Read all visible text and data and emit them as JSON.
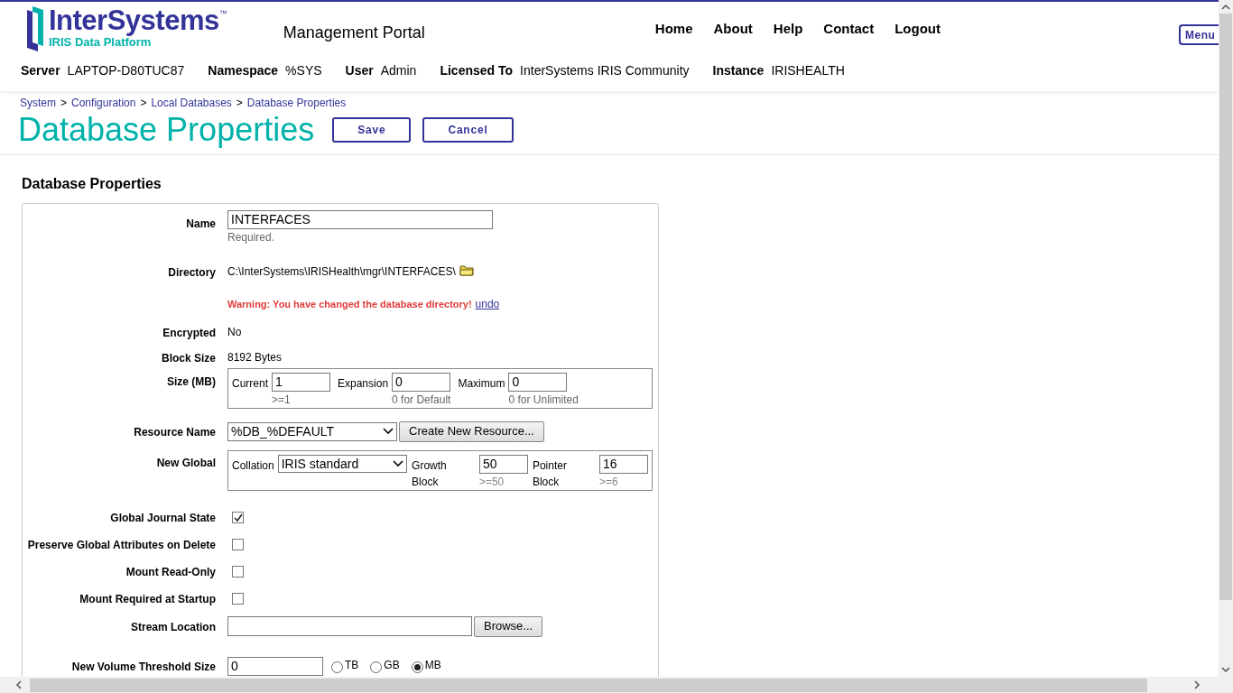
{
  "header": {
    "logo_name": "InterSystems",
    "logo_tm": "™",
    "logo_sub": "IRIS Data Platform",
    "title": "Management Portal",
    "nav": [
      "Home",
      "About",
      "Help",
      "Contact",
      "Logout"
    ],
    "menu_button": "Menu"
  },
  "info": [
    {
      "label": "Server",
      "value": "LAPTOP-D80TUC87"
    },
    {
      "label": "Namespace",
      "value": "%SYS"
    },
    {
      "label": "User",
      "value": "Admin"
    },
    {
      "label": "Licensed To",
      "value": "InterSystems IRIS Community"
    },
    {
      "label": "Instance",
      "value": "IRISHEALTH"
    }
  ],
  "breadcrumbs": {
    "separator": ">",
    "items": [
      "System",
      "Configuration",
      "Local Databases",
      "Database Properties"
    ]
  },
  "page_title": "Database Properties",
  "buttons": [
    "Save",
    "Cancel"
  ],
  "section_title": "Database Properties",
  "form": [
    {
      "kind": "text_input",
      "label": "Name",
      "value": "INTERFACES",
      "hint": "Required."
    },
    {
      "kind": "directory",
      "label": "Directory",
      "value": "C:\\InterSystems\\IRISHealth\\mgr\\INTERFACES\\",
      "warning": "Warning: You have changed the database directory!",
      "link": "undo"
    },
    {
      "kind": "static",
      "label": "Encrypted",
      "value": "No"
    },
    {
      "kind": "static",
      "label": "Block Size",
      "value": "8192 Bytes"
    },
    {
      "kind": "size_group",
      "label": "Size (MB)",
      "fields": [
        {
          "label": "Current",
          "value": "1",
          "hint": ">=1"
        },
        {
          "label": "Expansion",
          "value": "0",
          "hint": "0 for Default"
        },
        {
          "label": "Maximum",
          "value": "0",
          "hint": "0 for Unlimited"
        }
      ]
    },
    {
      "kind": "select_button",
      "label": "Resource Name",
      "value": "%DB_%DEFAULT",
      "button": "Create New Resource..."
    },
    {
      "kind": "new_global",
      "label": "New Global",
      "select_label": "Collation",
      "select_value": "IRIS standard",
      "fields": [
        {
          "label": "Growth Block",
          "value": "50",
          "hint": ">=50"
        },
        {
          "label": "Pointer Block",
          "value": "16",
          "hint": ">=6"
        }
      ]
    },
    {
      "kind": "checkbox",
      "label": "Global Journal State",
      "checked": true
    },
    {
      "kind": "checkbox",
      "label": "Preserve Global Attributes on Delete",
      "checked": false
    },
    {
      "kind": "checkbox",
      "label": "Mount Read-Only",
      "checked": false
    },
    {
      "kind": "checkbox",
      "label": "Mount Required at Startup",
      "checked": false
    },
    {
      "kind": "browse",
      "label": "Stream Location",
      "button": "Browse..."
    },
    {
      "kind": "threshold",
      "label": "New Volume Threshold Size",
      "value": "0",
      "units": [
        {
          "label": "TB",
          "selected": false
        },
        {
          "label": "GB",
          "selected": false
        },
        {
          "label": "MB",
          "selected": true
        }
      ]
    }
  ]
}
